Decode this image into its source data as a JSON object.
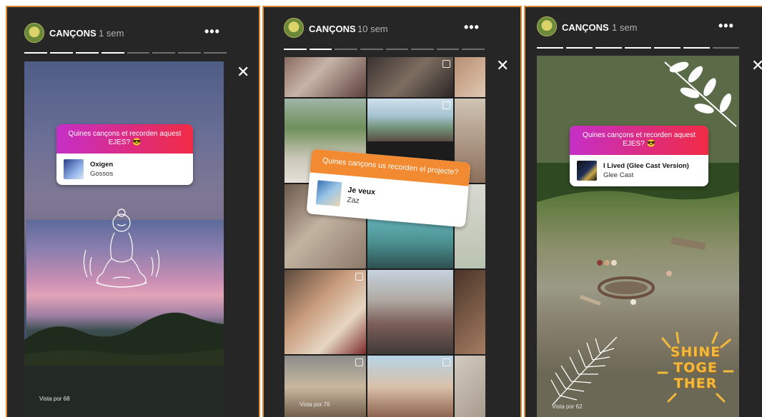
{
  "panels": [
    {
      "username": "CANÇONS",
      "time": "1 sem",
      "question": "Quines cançons et recorden aquest EJES? 😎",
      "song_title": "Oxigen",
      "song_artist": "Gossos",
      "views": "Vista por 68",
      "progress_segments": 8,
      "segments_viewed": 4
    },
    {
      "username": "CANÇONS",
      "time": "10 sem",
      "question": "Quines cançons us recorden el projecte?",
      "song_title": "Je veux",
      "song_artist": "Zaz",
      "views": "Vista por 76",
      "progress_segments": 8,
      "segments_viewed": 2
    },
    {
      "username": "CANÇONS",
      "time": "1 sem",
      "question": "Quines cançons et recorden aquest EJES? 😎",
      "song_title": "I Lived (Glee Cast Version)",
      "song_artist": "Glee Cast",
      "views": "Vista por 62",
      "sticker_text": "SHINE TOGE THER",
      "progress_segments": 7,
      "segments_viewed": 6
    }
  ],
  "icons": {
    "more": "•••",
    "close": "✕"
  },
  "colors": {
    "border": "#e08a3c",
    "panel_bg": "#262626",
    "question_gradient_start": "#c52ec7",
    "question_gradient_end": "#f12b45",
    "orange_card": "#f28a31"
  }
}
